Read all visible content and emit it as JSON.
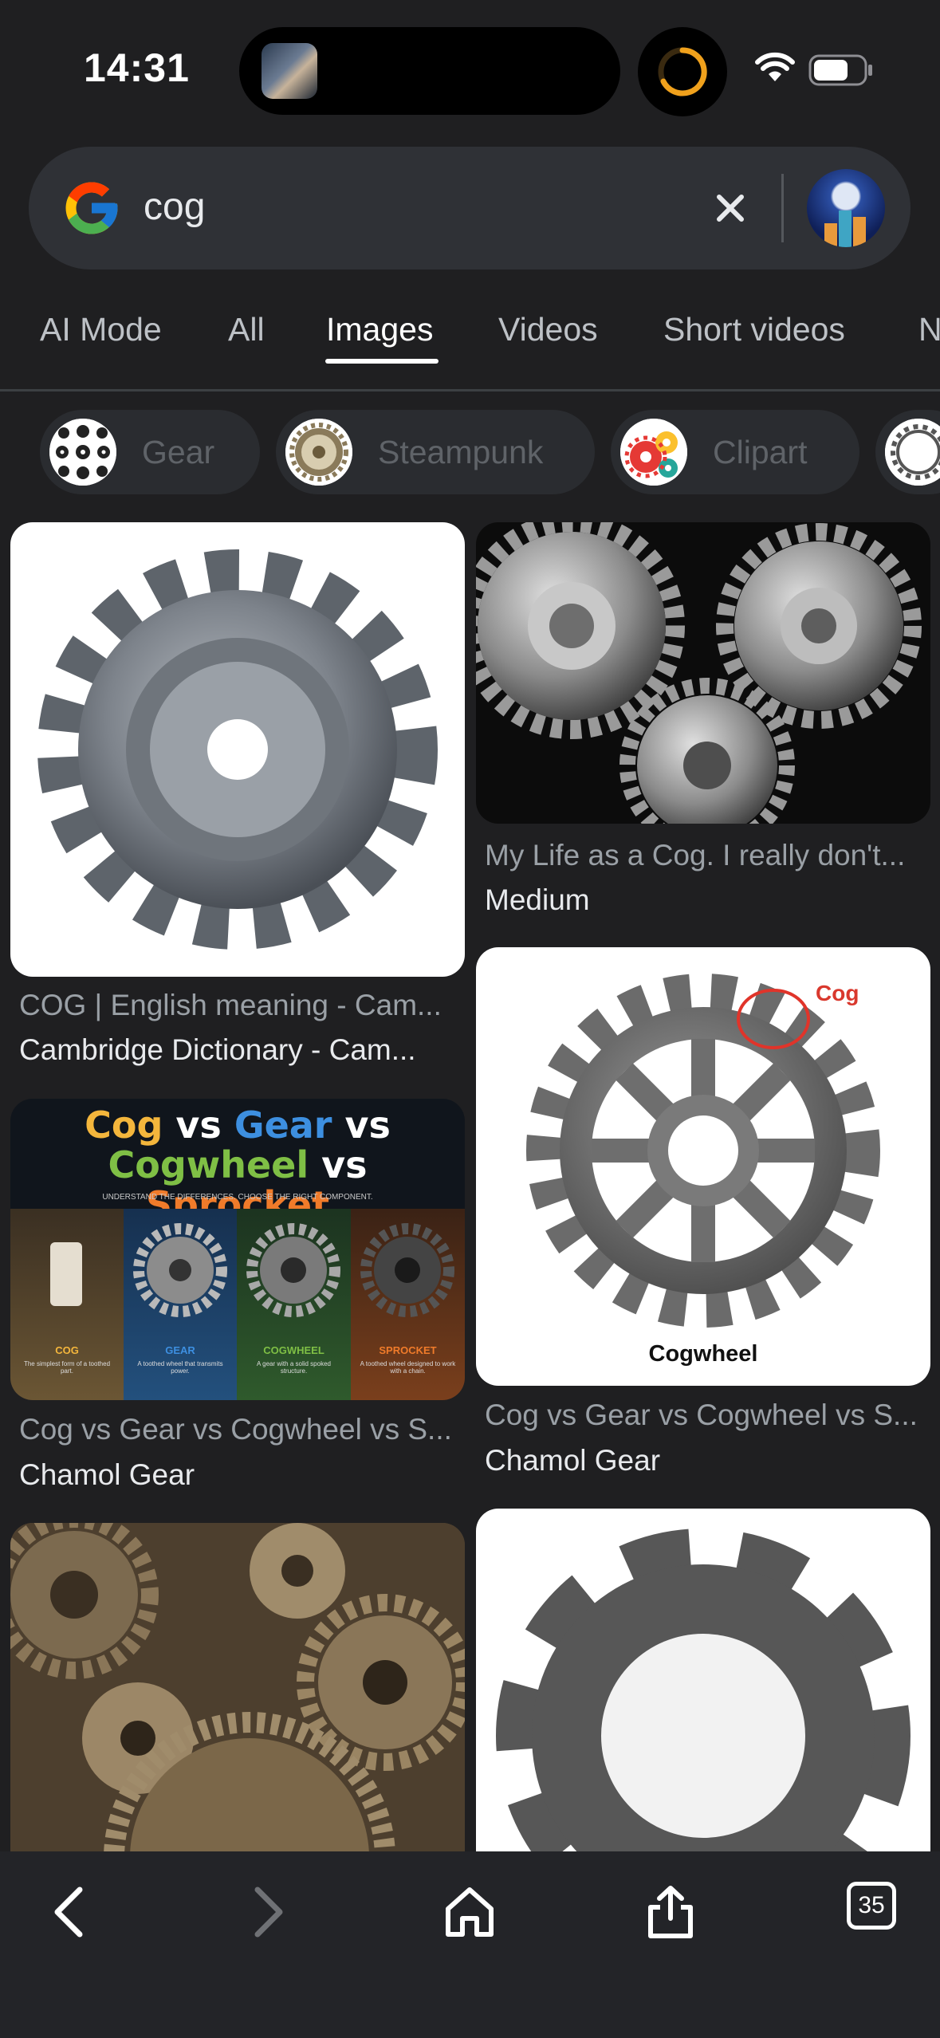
{
  "status_bar": {
    "time": "14:31",
    "icons": [
      "wifi-icon",
      "battery-icon",
      "media-progress-ring-icon"
    ]
  },
  "search": {
    "query": "cog",
    "clear_icon": "close-icon",
    "logo": "google-g-logo"
  },
  "tabs": [
    {
      "label": "AI Mode"
    },
    {
      "label": "All"
    },
    {
      "label": "Images",
      "active": true
    },
    {
      "label": "Videos"
    },
    {
      "label": "Short videos"
    },
    {
      "label": "N"
    }
  ],
  "chips": [
    {
      "label": "Gear"
    },
    {
      "label": "Steampunk"
    },
    {
      "label": "Clipart"
    }
  ],
  "results": [
    {
      "caption": "COG | English meaning - Cam...",
      "source": "Cambridge Dictionary - Cam..."
    },
    {
      "caption": "My Life as a Cog. I really don't...",
      "source": "Medium"
    },
    {
      "caption": "Cog vs Gear vs Cogwheel vs S...",
      "source": "Chamol Gear",
      "image_text": {
        "line1": [
          "Cog",
          " vs ",
          "Gear",
          " vs"
        ],
        "line2": [
          "Cogwheel",
          " vs ",
          "Sprocket"
        ],
        "tagline": "UNDERSTAND THE DIFFERENCES. CHOOSE THE RIGHT COMPONENT.",
        "panels": [
          {
            "name": "COG",
            "desc": "The simplest form of a toothed part."
          },
          {
            "name": "GEAR",
            "desc": "A toothed wheel that transmits power."
          },
          {
            "name": "COGWHEEL",
            "desc": "A gear with a solid spoked structure."
          },
          {
            "name": "SPROCKET",
            "desc": "A toothed wheel designed to work with a chain."
          }
        ]
      }
    },
    {
      "caption": "Cog vs Gear vs Cogwheel vs S...",
      "source": "Chamol Gear",
      "image_text": {
        "annotation": "Cog",
        "label": "Cogwheel"
      }
    },
    {
      "caption": "",
      "source": ""
    },
    {
      "caption": "",
      "source": ""
    }
  ],
  "toolbar": {
    "back_icon": "chevron-left-icon",
    "forward_icon": "chevron-right-icon",
    "home_icon": "home-icon",
    "share_icon": "share-icon",
    "tabs_icon": "tabs-icon",
    "tab_count": "35"
  },
  "colors": {
    "background": "#1f1f21",
    "search_box": "#2f3136",
    "chip": "#2a2c30",
    "caption": "#9aa0a6",
    "source": "#e8eaed"
  }
}
